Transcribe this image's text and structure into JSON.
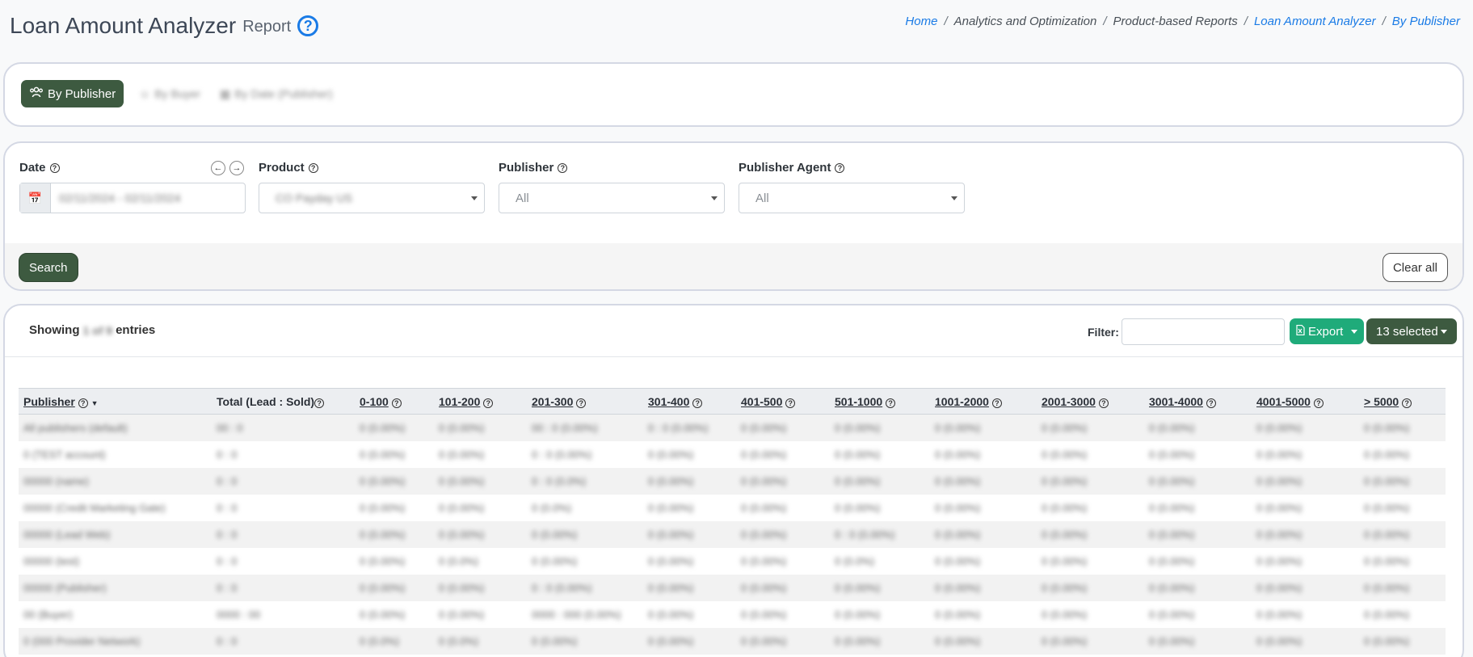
{
  "page": {
    "title": "Loan Amount Analyzer",
    "subtitle": "Report"
  },
  "breadcrumb": [
    {
      "label": "Home",
      "link": true
    },
    {
      "label": "Analytics and Optimization",
      "link": false
    },
    {
      "label": "Product-based Reports",
      "link": false
    },
    {
      "label": "Loan Amount Analyzer",
      "link": true
    },
    {
      "label": "By Publisher",
      "link": true
    }
  ],
  "tabs": {
    "active": "By Publisher",
    "other1": "By Buyer",
    "other2": "By Date (Publisher)"
  },
  "filters": {
    "date_label": "Date",
    "date_value": "02/11/2024 - 02/11/2024",
    "product_label": "Product",
    "product_value": "CO Payday US",
    "publisher_label": "Publisher",
    "publisher_value": "All",
    "agent_label": "Publisher Agent",
    "agent_value": "All",
    "search_label": "Search",
    "clear_label": "Clear all"
  },
  "results": {
    "showing_prefix": "Showing",
    "showing_count": "1 of 9",
    "showing_suffix": "entries",
    "filter_label": "Filter:",
    "export_label": "Export",
    "selected_label": "13 selected"
  },
  "table": {
    "headers": [
      "Publisher",
      "Total (Lead : Sold)",
      "0-100",
      "101-200",
      "201-300",
      "301-400",
      "401-500",
      "501-1000",
      "1001-2000",
      "2001-3000",
      "3001-4000",
      "4001-5000",
      "> 5000"
    ],
    "rows": [
      [
        "All publishers (default)",
        "00 : 0",
        "0 (0.00%)",
        "0 (0.00%)",
        "00 : 0 (0.00%)",
        "0 : 0 (0.00%)",
        "0 (0.00%)",
        "0 (0.00%)",
        "0 (0.00%)",
        "0 (0.00%)",
        "0 (0.00%)",
        "0 (0.00%)",
        "0 (0.00%)"
      ],
      [
        "0 (TEST account)",
        "0 : 0",
        "0 (0.00%)",
        "0 (0.00%)",
        "0 : 0 (0.00%)",
        "0 (0.00%)",
        "0 (0.00%)",
        "0 (0.00%)",
        "0 (0.00%)",
        "0 (0.00%)",
        "0 (0.00%)",
        "0 (0.00%)",
        "0 (0.00%)"
      ],
      [
        "00000 (name)",
        "0 : 0",
        "0 (0.00%)",
        "0 (0.00%)",
        "0 : 0 (0.0%)",
        "0 (0.00%)",
        "0 (0.00%)",
        "0 (0.00%)",
        "0 (0.00%)",
        "0 (0.00%)",
        "0 (0.00%)",
        "0 (0.00%)",
        "0 (0.00%)"
      ],
      [
        "00000 (Credit Marketing Gate)",
        "0 : 0",
        "0 (0.00%)",
        "0 (0.00%)",
        "0 (0.0%)",
        "0 (0.00%)",
        "0 (0.00%)",
        "0 (0.00%)",
        "0 (0.00%)",
        "0 (0.00%)",
        "0 (0.00%)",
        "0 (0.00%)",
        "0 (0.00%)"
      ],
      [
        "00000 (Lead Web)",
        "0 : 0",
        "0 (0.00%)",
        "0 (0.00%)",
        "0 (0.00%)",
        "0 (0.00%)",
        "0 (0.00%)",
        "0 : 0 (0.00%)",
        "0 (0.00%)",
        "0 (0.00%)",
        "0 (0.00%)",
        "0 (0.00%)",
        "0 (0.00%)"
      ],
      [
        "00000 (test)",
        "0 : 0",
        "0 (0.00%)",
        "0 (0.0%)",
        "0 (0.00%)",
        "0 (0.00%)",
        "0 (0.00%)",
        "0 (0.0%)",
        "0 (0.00%)",
        "0 (0.00%)",
        "0 (0.00%)",
        "0 (0.00%)",
        "0 (0.00%)"
      ],
      [
        "00000 (Publisher)",
        "0 : 0",
        "0 (0.00%)",
        "0 (0.00%)",
        "0 : 0 (0.00%)",
        "0 (0.00%)",
        "0 (0.00%)",
        "0 (0.00%)",
        "0 (0.00%)",
        "0 (0.00%)",
        "0 (0.00%)",
        "0 (0.00%)",
        "0 (0.00%)"
      ],
      [
        "00 (Buyer)",
        "0000 : 00",
        "0 (0.00%)",
        "0 (0.00%)",
        "0000 : 000 (0.00%)",
        "0 (0.00%)",
        "0 (0.00%)",
        "0 (0.00%)",
        "0 (0.00%)",
        "0 (0.00%)",
        "0 (0.00%)",
        "0 (0.00%)",
        "0 (0.00%)"
      ],
      [
        "0 (000 Provider Network)",
        "0 : 0",
        "0 (0.0%)",
        "0 (0.0%)",
        "0 (0.00%)",
        "0 (0.00%)",
        "0 (0.00%)",
        "0 (0.00%)",
        "0 (0.00%)",
        "0 (0.00%)",
        "0 (0.00%)",
        "0 (0.00%)",
        "0 (0.00%)"
      ]
    ]
  },
  "colors": {
    "brand_dark_green": "#3d5a40",
    "export_green": "#1fab7a",
    "link_blue": "#1a7be6"
  }
}
